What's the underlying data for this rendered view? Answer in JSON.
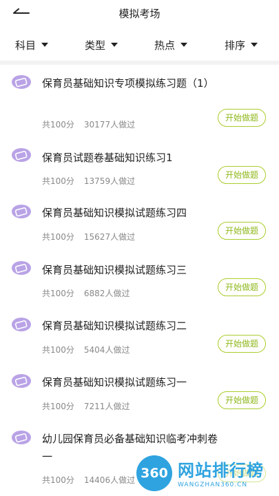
{
  "header": {
    "title": "模拟考场"
  },
  "filters": [
    {
      "label": "科目"
    },
    {
      "label": "类型"
    },
    {
      "label": "热点"
    },
    {
      "label": "排序"
    }
  ],
  "list": [
    {
      "title": "保育员基础知识专项模拟练习题（1）",
      "score": "共100分",
      "count": "30177人做过",
      "button": "开始做题"
    },
    {
      "title": "保育员试题卷基础知识练习1",
      "score": "共100分",
      "count": "13759人做过",
      "button": "开始做题"
    },
    {
      "title": "保育员基础知识模拟试题练习四",
      "score": "共100分",
      "count": "15627人做过",
      "button": "开始做题"
    },
    {
      "title": "保育员基础知识模拟试题练习三",
      "score": "共100分",
      "count": "6882人做过",
      "button": "开始做题"
    },
    {
      "title": "保育员基础知识模拟试题练习二",
      "score": "共100分",
      "count": "5404人做过",
      "button": "开始做题"
    },
    {
      "title": "保育员基础知识模拟试题练习一",
      "score": "共100分",
      "count": "7211人做过",
      "button": "开始做题"
    },
    {
      "title": "幼儿园保育员必备基础知识临考冲刺卷一",
      "score": "共100分",
      "count": "14406人做过",
      "button": "开始做题"
    }
  ],
  "watermark": {
    "logo": "360",
    "name": "网站排行榜",
    "url": "WANGZHAN360.CN"
  },
  "colors": {
    "accent": "#a8cc2a",
    "icon": "#b9a3e6",
    "watermark": "#2fa3e0"
  }
}
